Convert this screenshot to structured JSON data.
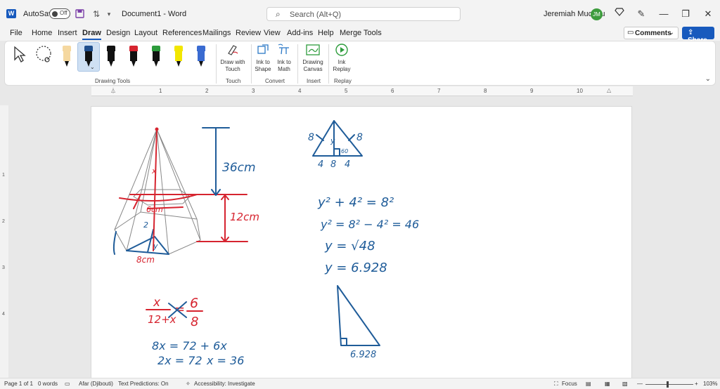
{
  "titlebar": {
    "autosave_label": "AutoSave",
    "toggle_state": "Off",
    "doc_title": "Document1 - Word",
    "search_placeholder": "Search (Alt+Q)",
    "user_name": "Jeremiah Mucunu",
    "user_initials": "JM"
  },
  "tabs": [
    "File",
    "Home",
    "Insert",
    "Draw",
    "Design",
    "Layout",
    "References",
    "Mailings",
    "Review",
    "View",
    "Add-ins",
    "Help",
    "Merge Tools"
  ],
  "active_tab": "Draw",
  "actions": {
    "comments": "Comments",
    "share": "Share"
  },
  "ribbon": {
    "groups": {
      "drawing_tools": "Drawing Tools",
      "touch": "Touch",
      "convert": "Convert",
      "insert": "Insert",
      "replay": "Replay"
    },
    "buttons": {
      "draw_with_touch_1": "Draw with",
      "draw_with_touch_2": "Touch",
      "ink_to_shape_1": "Ink to",
      "ink_to_shape_2": "Shape",
      "ink_to_math_1": "Ink to",
      "ink_to_math_2": "Math",
      "drawing_canvas_1": "Drawing",
      "drawing_canvas_2": "Canvas",
      "ink_replay_1": "Ink",
      "ink_replay_2": "Replay"
    },
    "pen_colors": [
      "#f5d8a0",
      "#1f4e8c",
      "#111111",
      "#d6242f",
      "#2d9c3c",
      "#f2e600",
      "#3a6bd1"
    ]
  },
  "ruler": {
    "numbers": [
      "1",
      "2",
      "3",
      "4",
      "5",
      "6",
      "7",
      "8",
      "9",
      "10"
    ]
  },
  "vruler": {
    "numbers": [
      "1",
      "2",
      "3",
      "4"
    ]
  },
  "ink": {
    "height_label": "36cm",
    "frustum_label": "12cm",
    "six_label": "6cm",
    "base_label": "8cm",
    "x_label": "x",
    "two_label": "2",
    "y_label": "y",
    "tri_left": "8",
    "tri_right": "8",
    "tri_bottom_left": "4",
    "tri_bottom_mid": "8",
    "tri_bottom_right": "4",
    "tri_y": "y",
    "tri_angle": "60",
    "eq1": "y² + 4² = 8²",
    "eq2": "y² = 8² − 4² = 46",
    "eq3": "y = √48",
    "eq4": "y = 6.928",
    "frac_x": "x",
    "frac_den_left": "12+x",
    "frac_equals": "=",
    "frac_six": "6",
    "frac_eight": "8",
    "line1": "8x = 72 + 6x",
    "line2": "2x = 72",
    "line3": "x = 36",
    "right_tri_label": "6.928"
  },
  "status": {
    "page": "Page 1 of 1",
    "words": "0 words",
    "language": "Afar (Djibouti)",
    "predictions": "Text Predictions: On",
    "accessibility": "Accessibility: Investigate",
    "focus": "Focus",
    "zoom": "103%"
  }
}
